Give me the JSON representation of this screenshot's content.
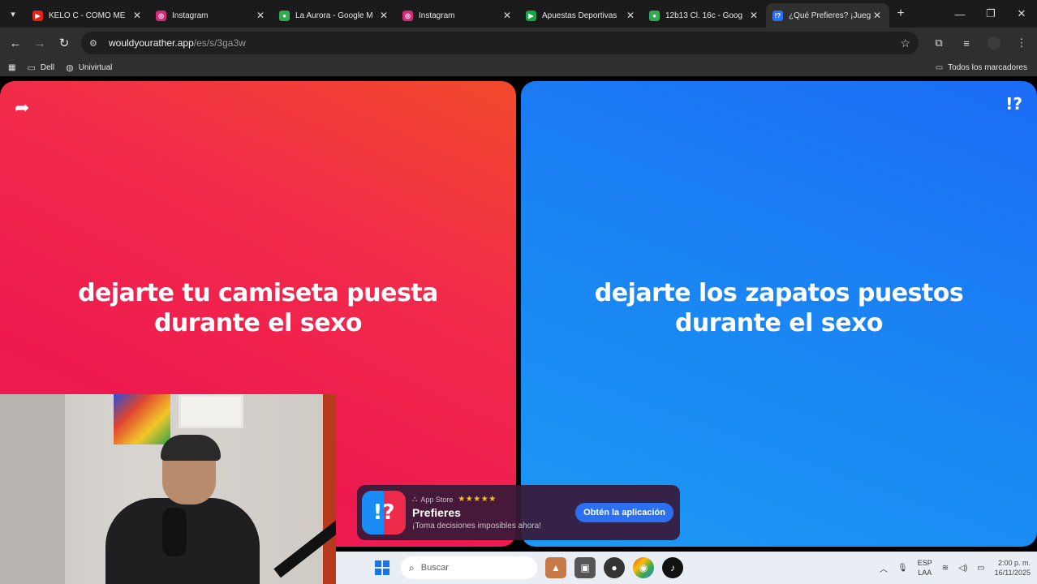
{
  "browser": {
    "tabs": [
      {
        "title": "KELO C - COMO ME",
        "favicon_color": "#e62117",
        "active": false
      },
      {
        "title": "Instagram",
        "favicon_color": "#d62976",
        "active": false
      },
      {
        "title": "La Aurora - Google M",
        "favicon_color": "#34a853",
        "active": false
      },
      {
        "title": "Instagram",
        "favicon_color": "#d62976",
        "active": false
      },
      {
        "title": "Apuestas Deportivas",
        "favicon_color": "#1aa34a",
        "active": false
      },
      {
        "title": "12b13 Cl. 16c - Goog",
        "favicon_color": "#34a853",
        "active": false
      },
      {
        "title": "¿Qué Prefieres? ¡Jueg",
        "favicon_color": "#2d6ff2",
        "active": true
      }
    ],
    "url_host": "wouldyourather.app",
    "url_path": "/es/s/3ga3w",
    "bookmarks": [
      {
        "label": "Dell"
      },
      {
        "label": "Univirtual"
      }
    ],
    "all_bookmarks_label": "Todos los marcadores"
  },
  "game": {
    "option_red": "dejarte tu camiseta puesta durante el sexo",
    "option_blue": "dejarte los zapatos puestos durante el sexo",
    "logo_text": "!?"
  },
  "banner": {
    "store": "App Store",
    "stars": "★★★★★",
    "app_name": "Prefieres",
    "tagline": "¡Toma decisiones imposibles ahora!",
    "cta": "Obtén la aplicación",
    "icon_text": "!?"
  },
  "taskbar": {
    "search_placeholder": "Buscar",
    "lang_top": "ESP",
    "lang_bottom": "LAA",
    "time": "2:00 p. m.",
    "date": "16/11/2025"
  },
  "colors": {
    "red_card": "#ee1a4f",
    "blue_card": "#1a85f3",
    "cta_blue": "#2d6ff2"
  }
}
